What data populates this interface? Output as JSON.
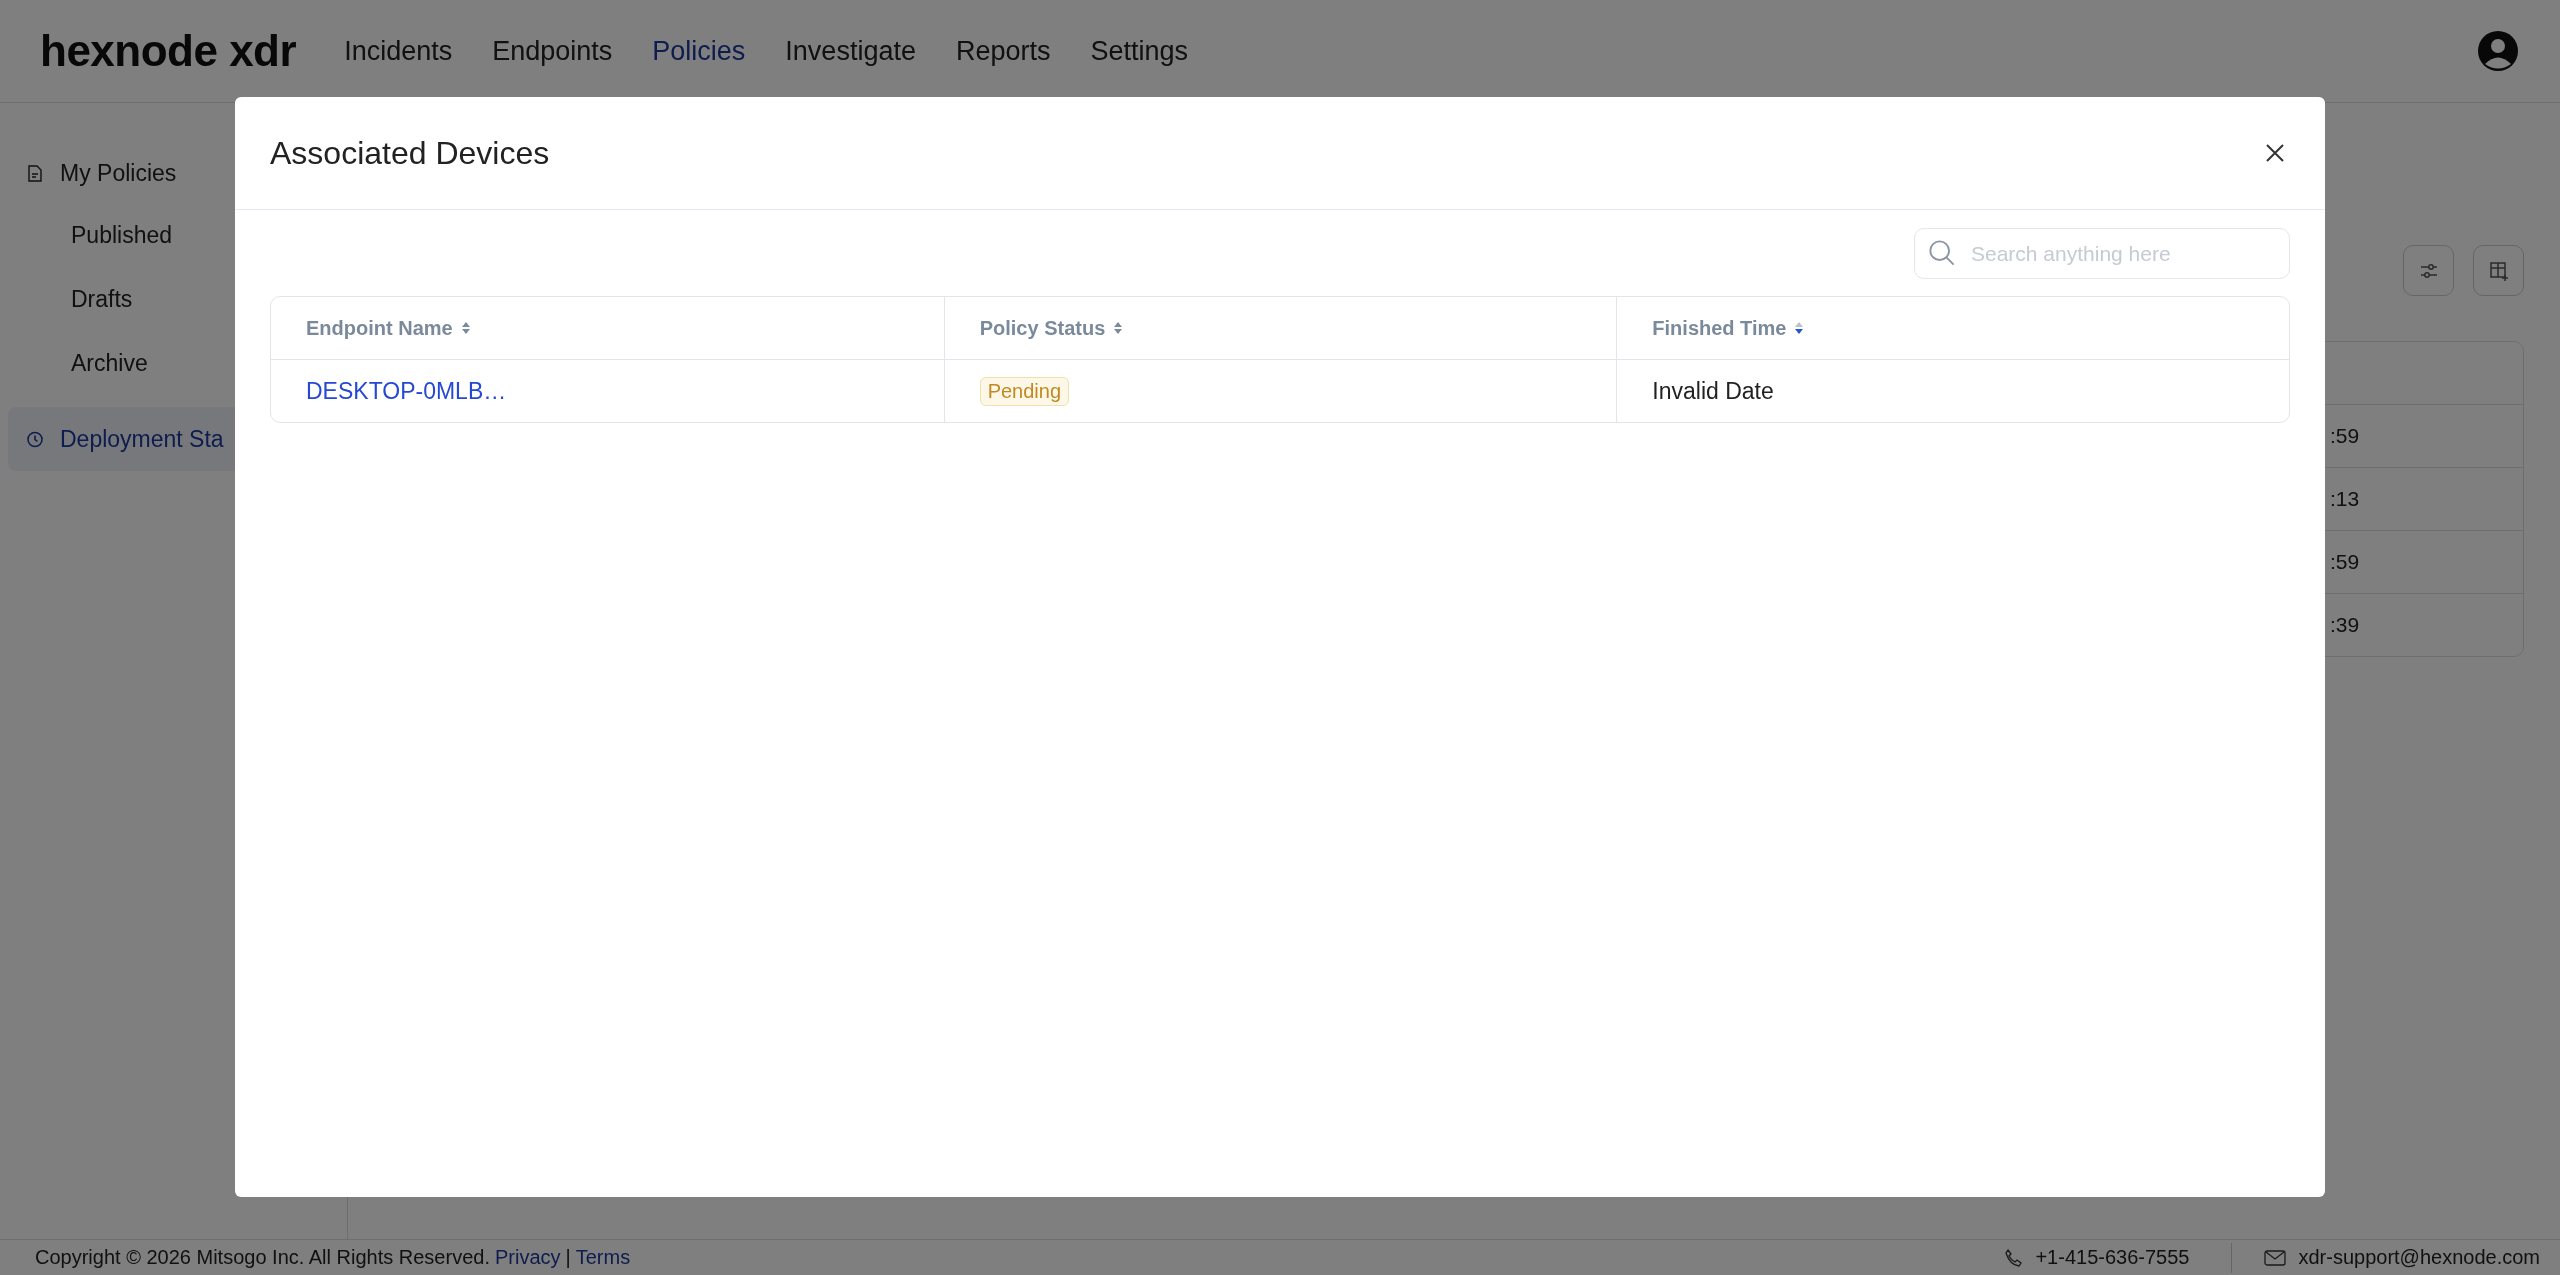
{
  "header": {
    "logo": "hexnode xdr",
    "nav": [
      {
        "label": "Incidents",
        "selected": false
      },
      {
        "label": "Endpoints",
        "selected": false
      },
      {
        "label": "Policies",
        "selected": true
      },
      {
        "label": "Investigate",
        "selected": false
      },
      {
        "label": "Reports",
        "selected": false
      },
      {
        "label": "Settings",
        "selected": false
      }
    ]
  },
  "sidebar": {
    "items": [
      {
        "label": "My Policies",
        "kind": "document",
        "selected": false,
        "children": [
          {
            "label": "Published",
            "selected": false
          },
          {
            "label": "Drafts",
            "selected": false
          },
          {
            "label": "Archive",
            "selected": false
          }
        ]
      },
      {
        "label": "Deployment Sta",
        "kind": "history",
        "selected": true
      }
    ]
  },
  "background_table": {
    "rows": [
      {
        "column_1": ":59"
      },
      {
        "column_1": ":13"
      },
      {
        "column_1": ":59"
      },
      {
        "column_1": ":39"
      }
    ]
  },
  "modal": {
    "title": "Associated Devices",
    "search": {
      "placeholder": "Search anything here"
    },
    "table": {
      "columns": [
        {
          "label": "Endpoint Name",
          "sorted": false
        },
        {
          "label": "Policy Status",
          "sorted": false
        },
        {
          "label": "Finished Time",
          "sorted": true
        }
      ],
      "rows": [
        {
          "endpoint_name": "DESKTOP-0MLB…",
          "policy_status": {
            "text": "Pending",
            "kind": "pending"
          },
          "finished_time": "Invalid Date"
        }
      ]
    }
  },
  "footer": {
    "copyright": "Copyright © 2026 Mitsogo Inc. All Rights Reserved.",
    "links": [
      "Privacy",
      "Terms"
    ],
    "separator": "|",
    "phone": "+1-415-636-7555",
    "email": "xdr-support@hexnode.com"
  }
}
